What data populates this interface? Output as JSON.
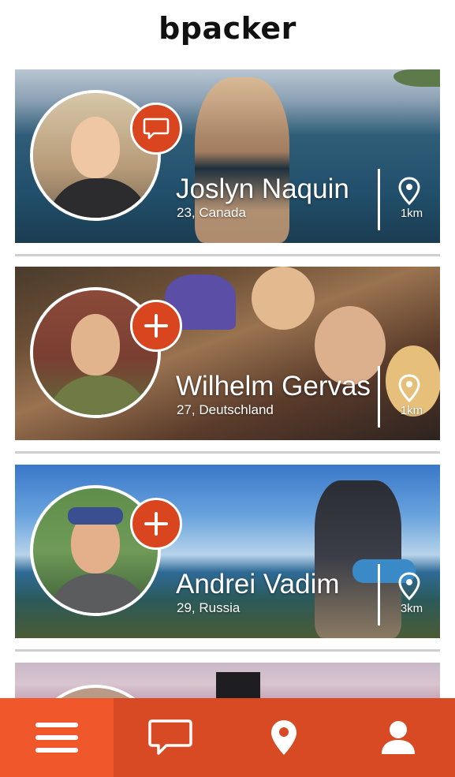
{
  "app": {
    "logo_text": "bpacker"
  },
  "colors": {
    "accent": "#d84a23",
    "accent_active": "#f0582b",
    "separator": "#cfcfcf"
  },
  "cards": [
    {
      "name": "Joslyn Naquin",
      "meta": "23, Canada",
      "distance": "1km",
      "action_icon": "chat-bubble-icon"
    },
    {
      "name": "Wilhelm Gervas",
      "meta": "27, Deutschland",
      "distance": "1km",
      "action_icon": "plus-icon"
    },
    {
      "name": "Andrei Vadim",
      "meta": "29, Russia",
      "distance": "3km",
      "action_icon": "plus-icon"
    }
  ],
  "tabbar": {
    "items": [
      {
        "icon": "hamburger-menu-icon",
        "active": true
      },
      {
        "icon": "chat-bubble-icon",
        "active": false
      },
      {
        "icon": "location-pin-icon",
        "active": false
      },
      {
        "icon": "user-profile-icon",
        "active": false
      }
    ]
  }
}
